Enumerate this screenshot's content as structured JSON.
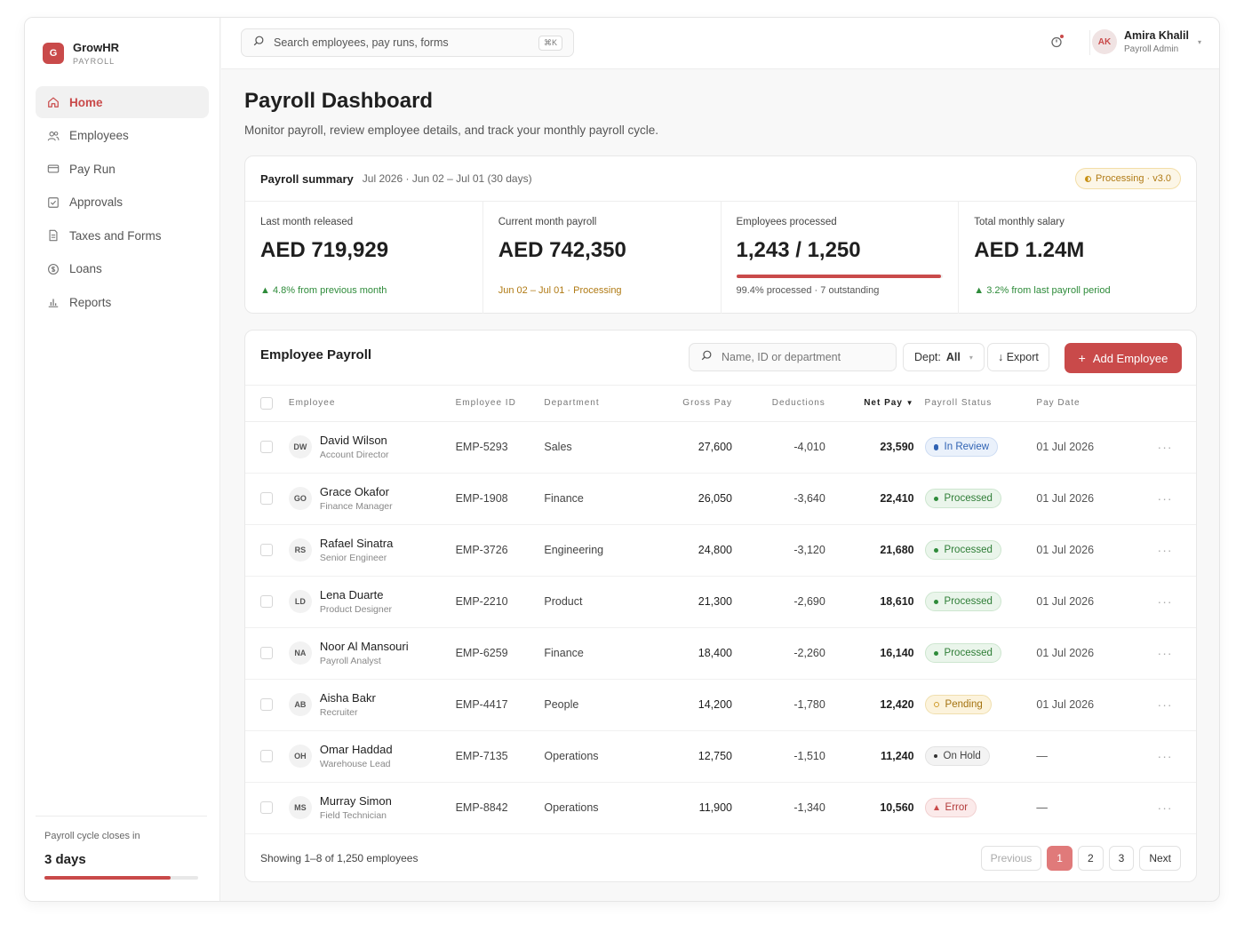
{
  "brand": {
    "logo": "G",
    "name": "GrowHR",
    "sub": "PAYROLL"
  },
  "nav": [
    {
      "label": "Home",
      "icon": "home-icon",
      "active": true
    },
    {
      "label": "Employees",
      "icon": "users-icon"
    },
    {
      "label": "Pay Run",
      "icon": "card-icon"
    },
    {
      "label": "Approvals",
      "icon": "check-square-icon"
    },
    {
      "label": "Taxes and Forms",
      "icon": "document-icon"
    },
    {
      "label": "Loans",
      "icon": "coin-icon"
    },
    {
      "label": "Reports",
      "icon": "bar-chart-icon"
    }
  ],
  "cycle": {
    "label": "Payroll cycle closes in",
    "days": "3 days",
    "progress": 0.82
  },
  "topbar": {
    "search_placeholder": "Search employees, pay runs, forms",
    "shortcut": "⌘K",
    "user_initials": "AK",
    "user_name": "Amira Khalil",
    "user_role": "Payroll Admin"
  },
  "page": {
    "title": "Payroll Dashboard",
    "subtitle": "Monitor payroll, review employee details, and track your monthly payroll cycle."
  },
  "summary": {
    "title": "Payroll summary",
    "period": "Jul 2026 · Jun 02 – Jul 01 (30 days)",
    "badge": "Processing · v3.0",
    "stats": [
      {
        "label": "Last month released",
        "value": "AED 719,929",
        "foot": "▲ 4.8% from previous month"
      },
      {
        "label": "Current month payroll",
        "value": "AED 742,350",
        "foot": "Jun 02 – Jul 01 · Processing"
      },
      {
        "label": "Employees processed",
        "value": "1,243 / 1,250",
        "foot": "99.4% processed · 7 outstanding",
        "progress": 0.994
      },
      {
        "label": "Total monthly salary",
        "value": "AED 1.24M",
        "foot": "▲ 3.2% from last payroll period"
      }
    ]
  },
  "payroll": {
    "title": "Employee Payroll",
    "search_placeholder": "Name, ID or department",
    "dept_label": "Dept:",
    "dept_value": "All",
    "export_label": "↓ Export",
    "add_label": "Add Employee",
    "columns": [
      "Employee",
      "Employee ID",
      "Department",
      "Gross Pay",
      "Deductions",
      "Net Pay",
      "Payroll Status",
      "Pay Date"
    ],
    "sort_arrow": "▼",
    "rows": [
      {
        "initials": "DW",
        "name": "David Wilson",
        "role": "Account Director",
        "id": "EMP-5293",
        "dept": "Sales",
        "gross": "27,600",
        "ded": "-4,010",
        "net": "23,590",
        "status": "In Review",
        "status_type": "review",
        "date": "01 Jul 2026"
      },
      {
        "initials": "GO",
        "name": "Grace Okafor",
        "role": "Finance Manager",
        "id": "EMP-1908",
        "dept": "Finance",
        "gross": "26,050",
        "ded": "-3,640",
        "net": "22,410",
        "status": "Processed",
        "status_type": "processed",
        "date": "01 Jul 2026"
      },
      {
        "initials": "RS",
        "name": "Rafael Sinatra",
        "role": "Senior Engineer",
        "id": "EMP-3726",
        "dept": "Engineering",
        "gross": "24,800",
        "ded": "-3,120",
        "net": "21,680",
        "status": "Processed",
        "status_type": "processed",
        "date": "01 Jul 2026"
      },
      {
        "initials": "LD",
        "name": "Lena Duarte",
        "role": "Product Designer",
        "id": "EMP-2210",
        "dept": "Product",
        "gross": "21,300",
        "ded": "-2,690",
        "net": "18,610",
        "status": "Processed",
        "status_type": "processed",
        "date": "01 Jul 2026"
      },
      {
        "initials": "NA",
        "name": "Noor Al Mansouri",
        "role": "Payroll Analyst",
        "id": "EMP-6259",
        "dept": "Finance",
        "gross": "18,400",
        "ded": "-2,260",
        "net": "16,140",
        "status": "Processed",
        "status_type": "processed",
        "date": "01 Jul 2026"
      },
      {
        "initials": "AB",
        "name": "Aisha Bakr",
        "role": "Recruiter",
        "id": "EMP-4417",
        "dept": "People",
        "gross": "14,200",
        "ded": "-1,780",
        "net": "12,420",
        "status": "Pending",
        "status_type": "pending",
        "date": "01 Jul 2026"
      },
      {
        "initials": "OH",
        "name": "Omar Haddad",
        "role": "Warehouse Lead",
        "id": "EMP-7135",
        "dept": "Operations",
        "gross": "12,750",
        "ded": "-1,510",
        "net": "11,240",
        "status": "On Hold",
        "status_type": "hold",
        "date": "—"
      },
      {
        "initials": "MS",
        "name": "Murray Simon",
        "role": "Field Technician",
        "id": "EMP-8842",
        "dept": "Operations",
        "gross": "11,900",
        "ded": "-1,340",
        "net": "10,560",
        "status": "Error",
        "status_type": "error",
        "date": "—"
      }
    ],
    "more_glyph": "···",
    "showing": "Showing 1–8 of 1,250 employees",
    "pager": {
      "previous": "Previous",
      "pages": [
        "1",
        "2",
        "3"
      ],
      "next": "Next",
      "current": "1"
    }
  }
}
